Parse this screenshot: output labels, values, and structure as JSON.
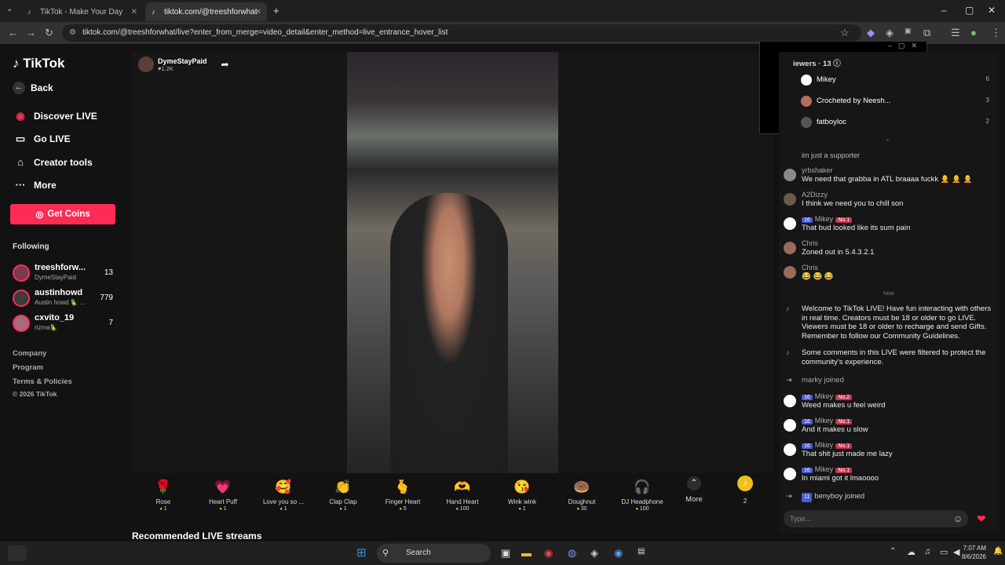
{
  "browser": {
    "tabs": [
      {
        "title": "TikTok - Make Your Day"
      },
      {
        "title": "tiktok.com/@treeshforwhat"
      }
    ],
    "url": "tiktok.com/@treeshforwhat/live?enter_from_merge=video_detail&enter_method=live_entrance_hover_list",
    "new_tab": "+"
  },
  "sidebar": {
    "logo": "TikTok",
    "back": "Back",
    "nav": [
      "Discover LIVE",
      "Go LIVE",
      "Creator tools",
      "More"
    ],
    "coins": "Get Coins",
    "following_title": "Following",
    "following": [
      {
        "name": "treeshforw...",
        "sub": "DymeStayPaid",
        "count": "13"
      },
      {
        "name": "austinhowd",
        "sub": "Austin howd 🦜 ...",
        "count": "779"
      },
      {
        "name": "cxvito_19",
        "sub": "rizma🦜",
        "count": "7"
      }
    ],
    "links": [
      "Company",
      "Program",
      "Terms & Policies",
      "© 2026 TikTok"
    ]
  },
  "stream": {
    "host_name": "DymeStayPaid",
    "likes": "♥1.2K",
    "gifts": [
      {
        "icon": "🌹",
        "name": "Rose",
        "price": "1"
      },
      {
        "icon": "💗",
        "name": "Heart Puff",
        "price": "1"
      },
      {
        "icon": "🥰",
        "name": "Love you so ...",
        "price": "1"
      },
      {
        "icon": "👏",
        "name": "Clap Clap",
        "price": "1"
      },
      {
        "icon": "🫰",
        "name": "Finger Heart",
        "price": "5"
      },
      {
        "icon": "🫶",
        "name": "Hand Heart",
        "price": "100"
      },
      {
        "icon": "😘",
        "name": "Wink wink",
        "price": "1"
      },
      {
        "icon": "🍩",
        "name": "Doughnut",
        "price": "30"
      },
      {
        "icon": "🎧",
        "name": "DJ Headphone",
        "price": "100"
      }
    ],
    "more": "More",
    "coin_count": "2",
    "recommended": "Recommended LIVE streams"
  },
  "chat": {
    "viewers_title": "iewers · 13 ⓘ",
    "viewers": [
      {
        "name": "Mikey",
        "rank": "6"
      },
      {
        "name": "Crocheted by Neesh...",
        "rank": "3"
      },
      {
        "name": "fatboyloc",
        "rank": "2"
      }
    ],
    "partial": "im just a supporter",
    "messages": [
      {
        "user": "yrbshaker",
        "text": "We need that grabba in ATL braaaa fuckk 🧑‍🦲 🧑‍🦲 🧑‍🦲"
      },
      {
        "user": "A2Dizzy",
        "text": "I think we need you to chill son"
      },
      {
        "user": "Mikey",
        "badge": "16",
        "badge2": "No.1",
        "text": "That bud looked like its sum pain"
      },
      {
        "user": "Chris",
        "text": "Zoned out in 5.4.3.2.1"
      },
      {
        "user": "Chris",
        "text": "😂 😂 😂"
      }
    ],
    "now": "Now",
    "sys1": "Welcome to TikTok LIVE! Have fun interacting with others in real time. Creators must be 18 or older to go LIVE. Viewers must be 18 or older to recharge and send Gifts. Remember to follow our Community Guidelines.",
    "sys2": "Some comments in this LIVE were filtered to protect the community's experience.",
    "joined1": "marky  joined",
    "messages2": [
      {
        "user": "Mikey",
        "badge": "16",
        "badge2": "No.2",
        "text": "Weed makes u feel weird"
      },
      {
        "user": "Mikey",
        "badge": "16",
        "badge2": "No.1",
        "text": "And it makes u slow"
      },
      {
        "user": "Mikey",
        "badge": "16",
        "badge2": "No.1",
        "text": "That shit just made me lazy"
      },
      {
        "user": "Mikey",
        "badge": "16",
        "badge2": "No.1",
        "text": "In miami got it lmaoooo"
      }
    ],
    "joined2": "benyboy  joined",
    "joined2_badge": "11",
    "placeholder": "Type..."
  },
  "taskbar": {
    "search": "Search",
    "time": "7:07 AM",
    "date": "8/6/2026"
  }
}
